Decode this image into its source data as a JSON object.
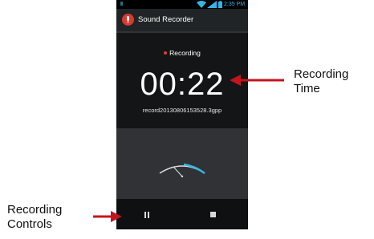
{
  "status_bar": {
    "time": "2:35 PM",
    "icons": [
      "wifi-icon",
      "signal-icon",
      "battery-icon"
    ],
    "accent_color": "#33b5e5"
  },
  "app_bar": {
    "icon": "microphone-app-icon",
    "title": "Sound Recorder"
  },
  "recorder": {
    "status": "Recording",
    "status_dot_color": "#e53935",
    "elapsed_time": "00:22",
    "filename": "record20130806153528.3gpp"
  },
  "level_meter": {
    "icon": "vu-meter-icon",
    "arc_color": "#33b5e5"
  },
  "controls": {
    "pause_icon": "pause-icon",
    "stop_icon": "stop-icon"
  },
  "annotations": {
    "time_label_line1": "Recording",
    "time_label_line2": "Time",
    "controls_label_line1": "Recording",
    "controls_label_line2": "Controls",
    "arrow_color": "#c0161c"
  }
}
